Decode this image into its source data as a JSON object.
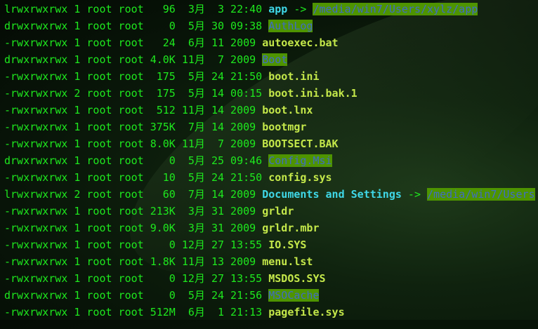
{
  "rows": [
    {
      "meta": "lrwxrwxrwx 1 root root   96  3月  3 22:40 ",
      "name": "app",
      "type": "link",
      "arrow": "->",
      "target": "/media/win7/Users/xylz/app"
    },
    {
      "meta": "drwxrwxrwx 1 root root    0  5月 30 09:38 ",
      "name": "AuthLog",
      "type": "dir"
    },
    {
      "meta": "-rwxrwxrwx 1 root root   24  6月 11 2009 ",
      "name": "autoexec.bat",
      "type": "file"
    },
    {
      "meta": "drwxrwxrwx 1 root root 4.0K 11月  7 2009 ",
      "name": "Boot",
      "type": "dir"
    },
    {
      "meta": "-rwxrwxrwx 1 root root  175  5月 24 21:50 ",
      "name": "boot.ini",
      "type": "file"
    },
    {
      "meta": "-rwxrwxrwx 2 root root  175  5月 14 00:15 ",
      "name": "boot.ini.bak.1",
      "type": "file"
    },
    {
      "meta": "-rwxrwxrwx 1 root root  512 11月 14 2009 ",
      "name": "boot.lnx",
      "type": "file"
    },
    {
      "meta": "-rwxrwxrwx 1 root root 375K  7月 14 2009 ",
      "name": "bootmgr",
      "type": "file"
    },
    {
      "meta": "-rwxrwxrwx 1 root root 8.0K 11月  7 2009 ",
      "name": "BOOTSECT.BAK",
      "type": "file"
    },
    {
      "meta": "drwxrwxrwx 1 root root    0  5月 25 09:46 ",
      "name": "Config.Msi",
      "type": "dir"
    },
    {
      "meta": "-rwxrwxrwx 1 root root   10  5月 24 21:50 ",
      "name": "config.sys",
      "type": "file"
    },
    {
      "meta": "lrwxrwxrwx 2 root root   60  7月 14 2009 ",
      "name": "Documents and Settings",
      "type": "link",
      "arrow": "->",
      "target": "/media/win7/Users"
    },
    {
      "meta": "-rwxrwxrwx 1 root root 213K  3月 31 2009 ",
      "name": "grldr",
      "type": "file"
    },
    {
      "meta": "-rwxrwxrwx 1 root root 9.0K  3月 31 2009 ",
      "name": "grldr.mbr",
      "type": "file"
    },
    {
      "meta": "-rwxrwxrwx 1 root root    0 12月 27 13:55 ",
      "name": "IO.SYS",
      "type": "file"
    },
    {
      "meta": "-rwxrwxrwx 1 root root 1.8K 11月 13 2009 ",
      "name": "menu.lst",
      "type": "file"
    },
    {
      "meta": "-rwxrwxrwx 1 root root    0 12月 27 13:55 ",
      "name": "MSDOS.SYS",
      "type": "file"
    },
    {
      "meta": "drwxrwxrwx 1 root root    0  5月 24 21:56 ",
      "name": "MSOCache",
      "type": "dir"
    },
    {
      "meta": "-rwxrwxrwx 1 root root 512M  6月  1 21:13 ",
      "name": "pagefile.sys",
      "type": "file"
    }
  ]
}
